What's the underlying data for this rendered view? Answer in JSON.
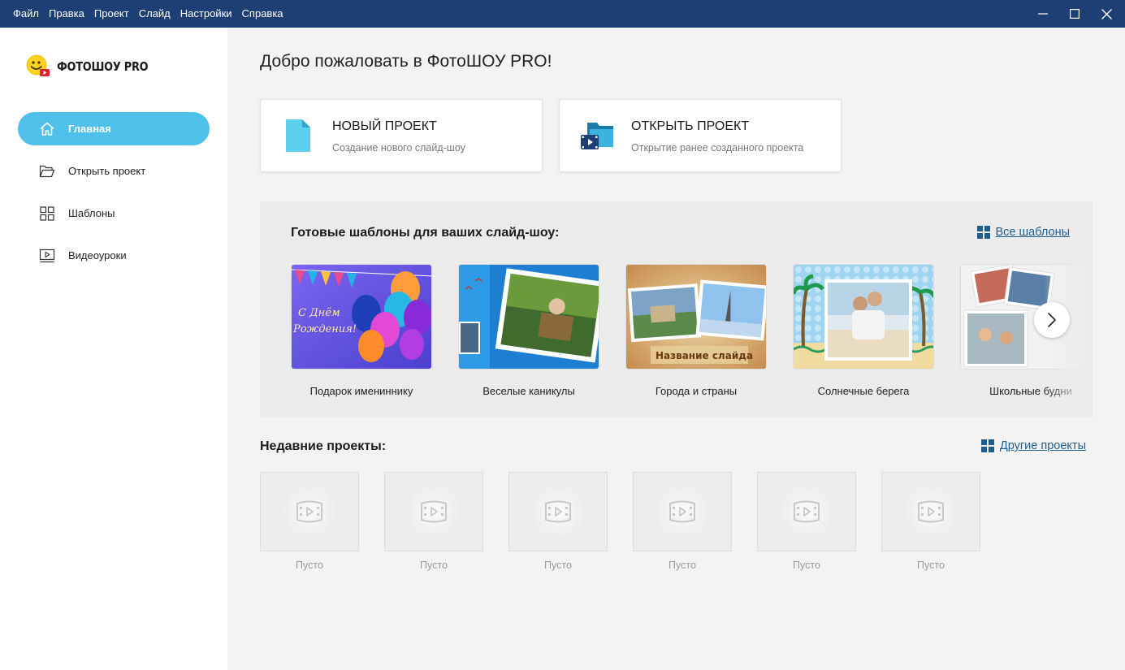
{
  "menu": [
    "Файл",
    "Правка",
    "Проект",
    "Слайд",
    "Настройки",
    "Справка"
  ],
  "app": {
    "logo_text": "ФОТОШОУ PRO"
  },
  "nav": [
    {
      "label": "Главная",
      "icon": "home-icon",
      "active": true
    },
    {
      "label": "Открыть проект",
      "icon": "folder-open-icon",
      "active": false
    },
    {
      "label": "Шаблоны",
      "icon": "grid-icon",
      "active": false
    },
    {
      "label": "Видеоуроки",
      "icon": "video-lesson-icon",
      "active": false
    }
  ],
  "main": {
    "welcome": "Добро пожаловать в ФотоШОУ PRO!",
    "new_project": {
      "title": "НОВЫЙ ПРОЕКТ",
      "subtitle": "Создание нового слайд-шоу"
    },
    "open_project": {
      "title": "ОТКРЫТЬ ПРОЕКТ",
      "subtitle": "Открытие ранее созданного проекта"
    }
  },
  "templates": {
    "title": "Готовые шаблоны для ваших слайд-шоу:",
    "all_link": "Все шаблоны",
    "items": [
      {
        "label": "Подарок имениннику",
        "thumb_text": "С Днём\nРождения!"
      },
      {
        "label": "Веселые каникулы"
      },
      {
        "label": "Города и страны",
        "thumb_text": "Название слайда"
      },
      {
        "label": "Солнечные берега"
      },
      {
        "label": "Школьные будни"
      }
    ]
  },
  "recent": {
    "title": "Недавние проекты:",
    "other_link": "Другие проекты",
    "items": [
      "Пусто",
      "Пусто",
      "Пусто",
      "Пусто",
      "Пусто",
      "Пусто"
    ]
  },
  "colors": {
    "titlebar": "#1e3f73",
    "accent": "#4ec0e9",
    "link": "#1f5d8f"
  }
}
